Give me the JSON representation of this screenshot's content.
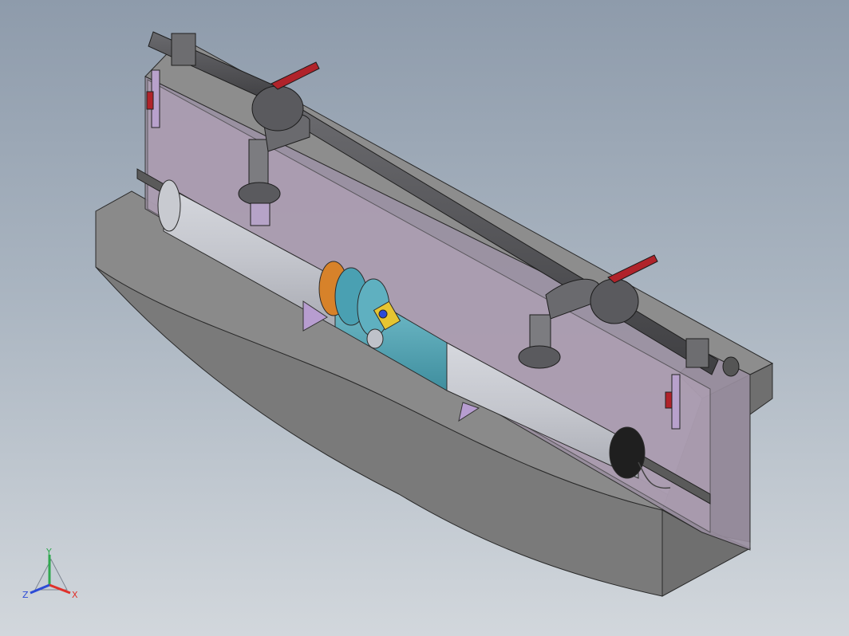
{
  "triad": {
    "x_label": "X",
    "y_label": "Y",
    "z_label": "Z",
    "colors": {
      "x": "#e0302a",
      "y": "#2fa84f",
      "z": "#2c4bd6"
    }
  },
  "colors": {
    "concrete": "#7d7d7d",
    "glass_panel": "#a99aa8",
    "pvc_pipe": "#c9cbd1",
    "dark_pipe": "#4c4c4f",
    "valve_handle": "#b0232a",
    "uv_band": "#5fb0c0",
    "orange_band": "#d7822a"
  }
}
